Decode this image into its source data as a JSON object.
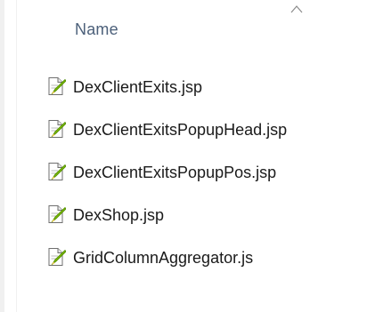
{
  "header": {
    "name_column_label": "Name",
    "sort_indicator": "chevron-up-icon"
  },
  "files": [
    {
      "name": "DexClientExits.jsp",
      "icon": "script-file-icon"
    },
    {
      "name": "DexClientExitsPopupHead.jsp",
      "icon": "script-file-icon"
    },
    {
      "name": "DexClientExitsPopupPos.jsp",
      "icon": "script-file-icon"
    },
    {
      "name": "DexShop.jsp",
      "icon": "script-file-icon"
    },
    {
      "name": "GridColumnAggregator.js",
      "icon": "script-file-icon"
    }
  ],
  "colors": {
    "header_text": "#4c607a",
    "file_text": "#1a1a1a",
    "icon_accent": "#7ab800"
  }
}
